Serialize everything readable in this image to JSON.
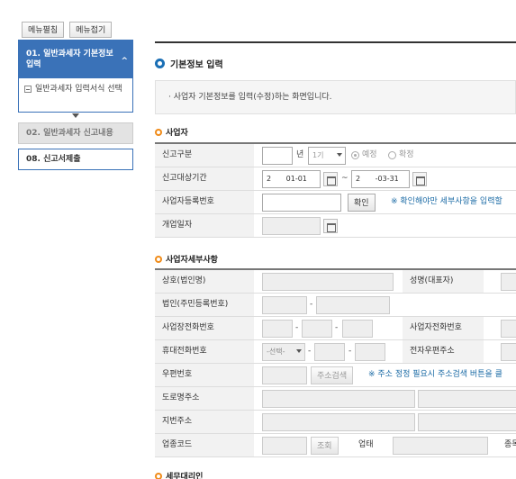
{
  "sidebar": {
    "expand_label": "메뉴펼침",
    "collapse_label": "메뉴접기",
    "active_step": "01. 일반과세자 기본정보 입력",
    "active_caret": "^",
    "sub_item": "일반과세자 입력서식 선택",
    "step2": "02. 일반과세자 신고내용",
    "step3": "08. 신고서제출"
  },
  "main": {
    "title": "기본정보 입력",
    "info": "· 사업자 기본정보를 입력(수정)하는 화면입니다."
  },
  "biz": {
    "section_title": "사업자",
    "report_type_label": "신고구분",
    "year_suffix": "년",
    "period_value": "1기",
    "radio_scheduled": "예정",
    "radio_final": "확정",
    "period_label": "신고대상기간",
    "start_year": "2",
    "start_date": "01-01",
    "tilde": "~",
    "end_year": "2",
    "end_date": "-03-31",
    "reg_no_label": "사업자등록번호",
    "confirm_button": "확인",
    "confirm_note": "※ 확인해야만 세부사항을 입력할",
    "open_date_label": "개업일자"
  },
  "detail": {
    "section_title": "사업자세부사항",
    "company_label": "상호(법인명)",
    "ceo_label": "성명(대표자)",
    "corp_no_label": "법인(주민등록번호)",
    "biz_phone_label": "사업장전화번호",
    "biz_phone2_label": "사업자전화번호",
    "mobile_label": "휴대전화번호",
    "mobile_select": "-선택-",
    "email_label": "전자우편주소",
    "postal_label": "우편번호",
    "address_search_button": "주소검색",
    "address_note": "※ 주소 정정 필요시 주소검색 버튼을 클",
    "road_address_label": "도로명주소",
    "lot_address_label": "지번주소",
    "industry_code_label": "업종코드",
    "lookup_button": "조회",
    "business_type_label": "업태",
    "item_label": "종목"
  },
  "agent": {
    "section_title": "세무대리인"
  },
  "colors": {
    "accent_blue": "#3a72b8",
    "section_orange": "#f08c1a",
    "note_blue": "#1a6aa5"
  }
}
